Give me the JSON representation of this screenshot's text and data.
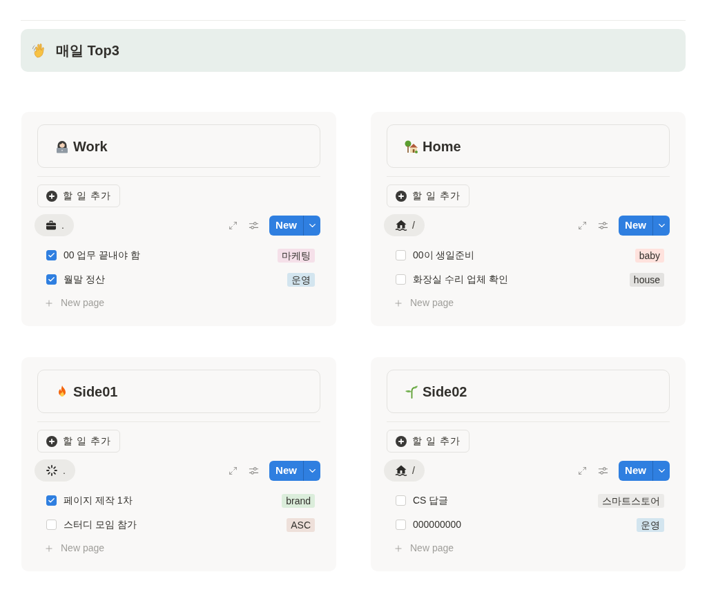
{
  "callout": {
    "title": "매일 Top3"
  },
  "boards": [
    {
      "title": "Work",
      "add_button": "할 일 추가",
      "view": {
        "label": ".",
        "selected": true
      },
      "new_button": "New",
      "tasks": [
        {
          "title": "00 업무 끝내야 함",
          "checked": true,
          "tag": {
            "label": "마케팅",
            "color": "#f5e0e9"
          }
        },
        {
          "title": "월말 정산",
          "checked": true,
          "tag": {
            "label": "운영",
            "color": "#d3e5ef"
          }
        }
      ],
      "new_page": "New page"
    },
    {
      "title": "Home",
      "add_button": "할 일 추가",
      "view": {
        "label": "/",
        "selected": true
      },
      "new_button": "New",
      "tasks": [
        {
          "title": "00이 생일준비",
          "checked": false,
          "tag": {
            "label": "baby",
            "color": "#ffe2dd"
          }
        },
        {
          "title": "화장실 수리 업체 확인",
          "checked": false,
          "tag": {
            "label": "house",
            "color": "#e3e2e0"
          }
        }
      ],
      "new_page": "New page"
    },
    {
      "title": "Side01",
      "add_button": "할 일 추가",
      "view": {
        "label": ".",
        "selected": true
      },
      "new_button": "New",
      "tasks": [
        {
          "title": "페이지 제작 1차",
          "checked": true,
          "tag": {
            "label": "brand",
            "color": "#dbeddb"
          }
        },
        {
          "title": "스터디 모임 참가",
          "checked": false,
          "tag": {
            "label": "ASC",
            "color": "#eee0da"
          }
        }
      ],
      "new_page": "New page"
    },
    {
      "title": "Side02",
      "add_button": "할 일 추가",
      "view": {
        "label": "/",
        "selected": true
      },
      "new_button": "New",
      "tasks": [
        {
          "title": "CS 답글",
          "checked": false,
          "tag": {
            "label": "스마트스토어",
            "color": "#ebeae8"
          }
        },
        {
          "title": "000000000",
          "checked": false,
          "tag": {
            "label": "운영",
            "color": "#d3e5ef"
          }
        }
      ],
      "new_page": "New page"
    }
  ]
}
